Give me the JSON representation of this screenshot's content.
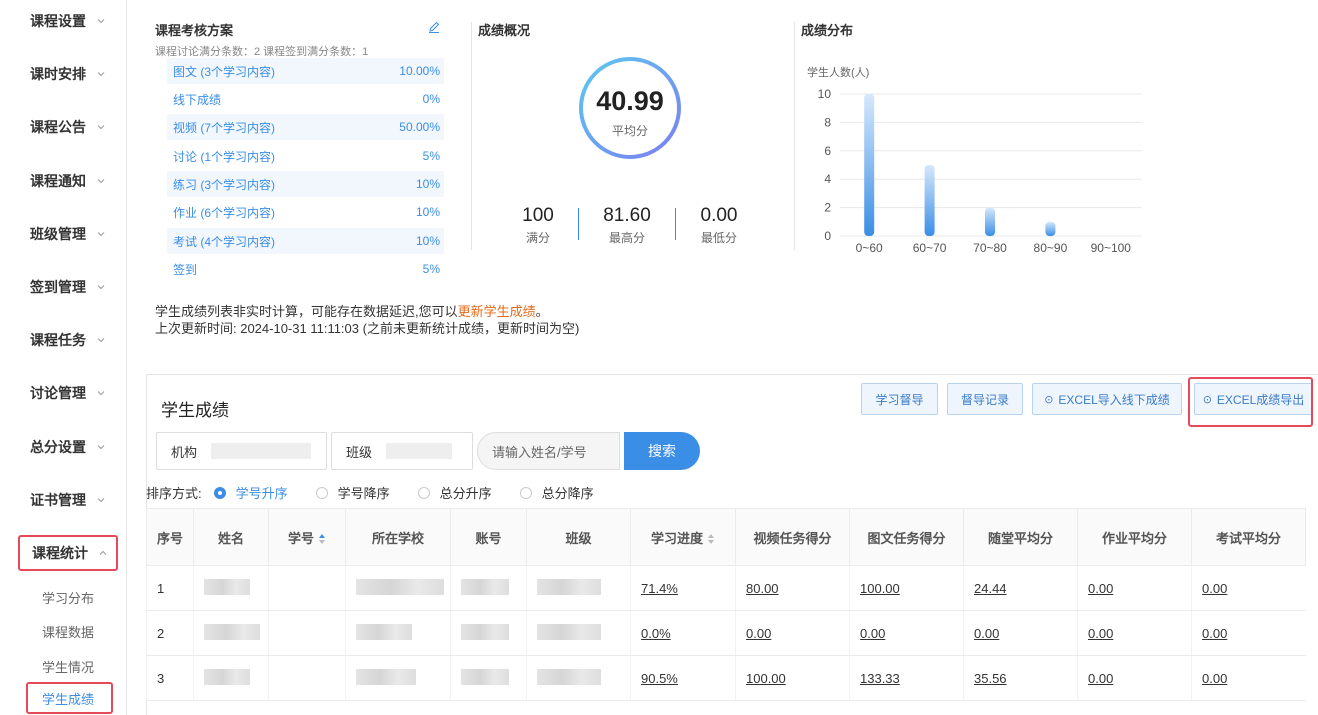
{
  "sidebar": {
    "items": [
      {
        "label": "课程设置"
      },
      {
        "label": "课时安排"
      },
      {
        "label": "课程公告"
      },
      {
        "label": "课程通知"
      },
      {
        "label": "班级管理"
      },
      {
        "label": "签到管理"
      },
      {
        "label": "课程任务"
      },
      {
        "label": "讨论管理"
      },
      {
        "label": "总分设置"
      },
      {
        "label": "证书管理"
      },
      {
        "label": "课程统计"
      }
    ],
    "sub_items": [
      {
        "label": "学习分布"
      },
      {
        "label": "课程数据"
      },
      {
        "label": "学生情况"
      },
      {
        "label": "学生成绩"
      }
    ]
  },
  "plan": {
    "title": "课程考核方案",
    "note": "课程讨论满分条数：2   课程签到满分条数：1",
    "rows": [
      {
        "name": "图文   (3个学习内容)",
        "pct": "10.00%"
      },
      {
        "name": "线下成绩",
        "pct": "0%"
      },
      {
        "name": "视频   (7个学习内容)",
        "pct": "50.00%"
      },
      {
        "name": "讨论   (1个学习内容)",
        "pct": "5%"
      },
      {
        "name": "练习   (3个学习内容)",
        "pct": "10%"
      },
      {
        "name": "作业   (6个学习内容)",
        "pct": "10%"
      },
      {
        "name": "考试   (4个学习内容)",
        "pct": "10%"
      },
      {
        "name": "签到",
        "pct": "5%"
      }
    ]
  },
  "overview": {
    "title": "成绩概况",
    "avg_value": "40.99",
    "avg_label": "平均分",
    "stats": [
      {
        "value": "100",
        "label": "满分"
      },
      {
        "value": "81.60",
        "label": "最高分"
      },
      {
        "value": "0.00",
        "label": "最低分"
      }
    ]
  },
  "distribution": {
    "title": "成绩分布",
    "chart_data": {
      "type": "bar",
      "ylabel": "学生人数(人)",
      "categories": [
        "0~60",
        "60~70",
        "70~80",
        "80~90",
        "90~100"
      ],
      "values": [
        10,
        5,
        2,
        1,
        0
      ],
      "ylim": [
        0,
        10
      ],
      "yticks": [
        0,
        2,
        4,
        6,
        8,
        10
      ],
      "grid": true,
      "color": "#3a8ee6"
    }
  },
  "notice": {
    "line1_pre": "学生成绩列表非实时计算，可能存在数据延迟,您可以",
    "line1_link": "更新学生成绩",
    "line1_post": "。",
    "line2": "上次更新时间: 2024-10-31 11:11:03 (之前未更新统计成绩，更新时间为空)"
  },
  "grades": {
    "title": "学生成绩",
    "buttons": {
      "supervise": "学习督导",
      "supervise_log": "督导记录",
      "import": "EXCEL导入线下成绩",
      "export": "EXCEL成绩导出"
    },
    "filters": {
      "org_label": "机构",
      "class_label": "班级",
      "search_placeholder": "请输入姓名/学号",
      "search_button": "搜索"
    },
    "sort": {
      "label": "排序方式:",
      "options": [
        "学号升序",
        "学号降序",
        "总分升序",
        "总分降序"
      ]
    },
    "columns": [
      "序号",
      "姓名",
      "学号",
      "所在学校",
      "账号",
      "班级",
      "学习进度",
      "视频任务得分",
      "图文任务得分",
      "随堂平均分",
      "作业平均分",
      "考试平均分"
    ],
    "rows": [
      {
        "index": "1",
        "progress": "71.4%",
        "video": "80.00",
        "text": "100.00",
        "quiz": "24.44",
        "homework": "0.00",
        "exam": "0.00"
      },
      {
        "index": "2",
        "progress": "0.0%",
        "video": "0.00",
        "text": "0.00",
        "quiz": "0.00",
        "homework": "0.00",
        "exam": "0.00"
      },
      {
        "index": "3",
        "progress": "90.5%",
        "video": "100.00",
        "text": "133.33",
        "quiz": "35.56",
        "homework": "0.00",
        "exam": "0.00"
      }
    ]
  }
}
